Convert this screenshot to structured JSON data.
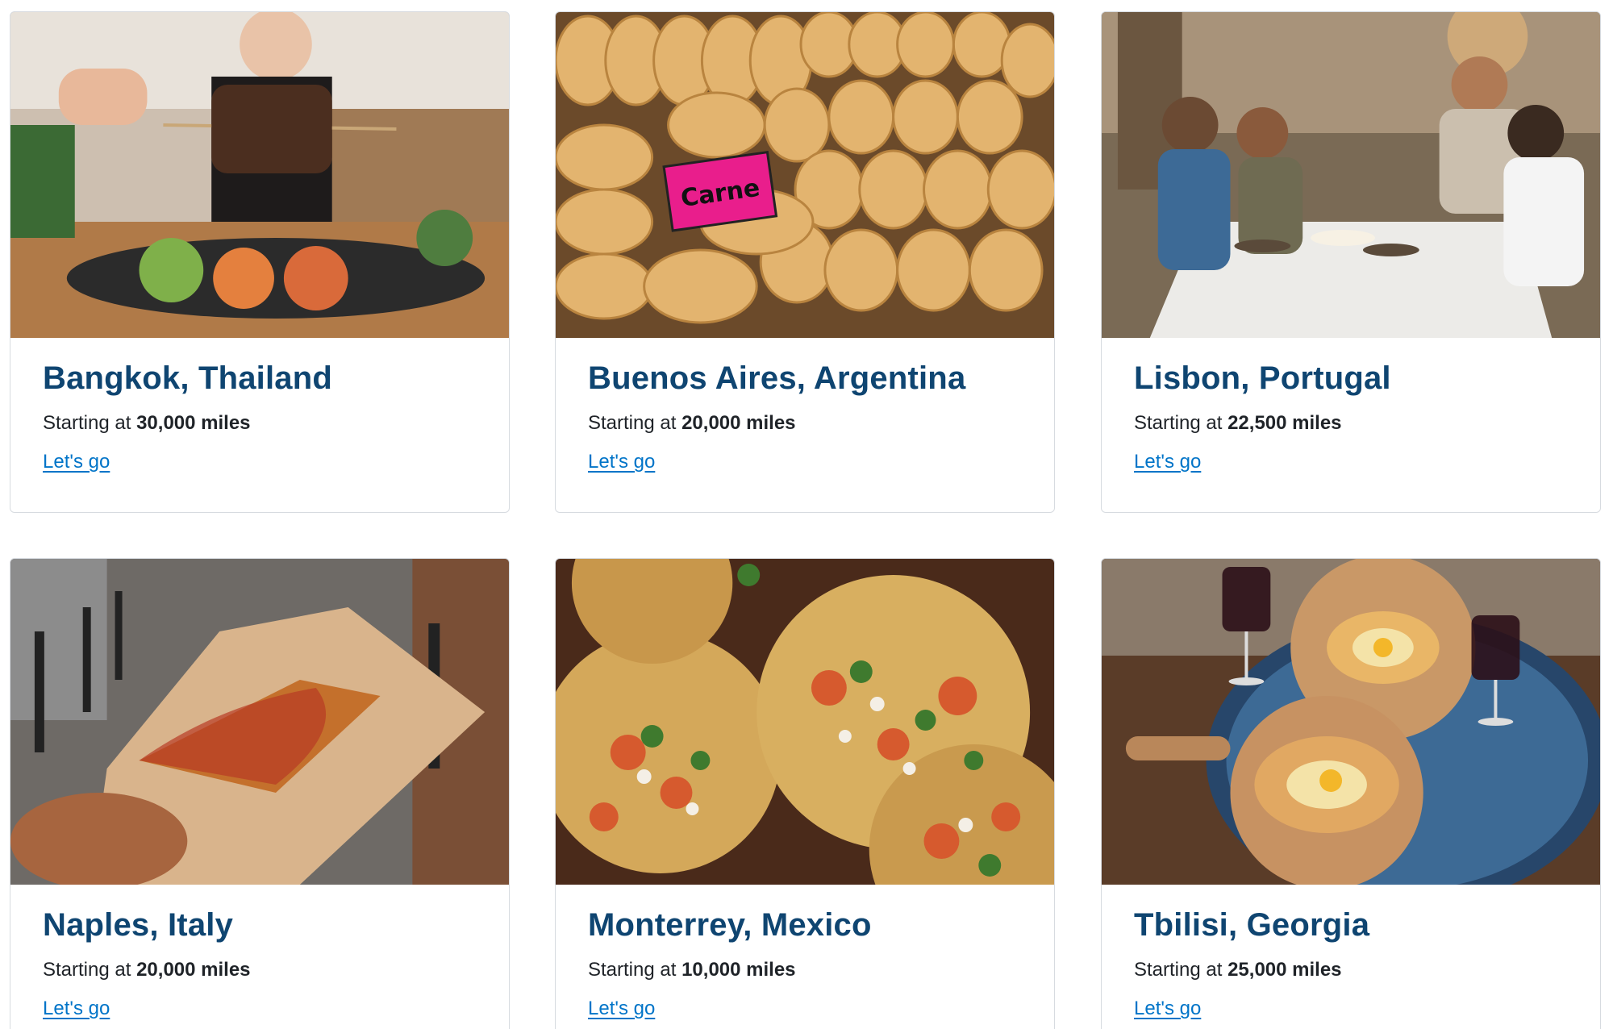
{
  "cards": [
    {
      "title": "Bangkok, Thailand",
      "prefix": "Starting at",
      "miles": "30,000 miles",
      "cta": "Let's go",
      "image": "thai-food-skewer-photo"
    },
    {
      "title": "Buenos Aires, Argentina",
      "prefix": "Starting at",
      "miles": "20,000 miles",
      "cta": "Let's go",
      "image": "empanadas-photo",
      "sign": "Carne"
    },
    {
      "title": "Lisbon, Portugal",
      "prefix": "Starting at",
      "miles": "22,500 miles",
      "cta": "Let's go",
      "image": "outdoor-dinner-toast-photo"
    },
    {
      "title": "Naples, Italy",
      "prefix": "Starting at",
      "miles": "20,000 miles",
      "cta": "Let's go",
      "image": "pizza-fold-street-photo"
    },
    {
      "title": "Monterrey, Mexico",
      "prefix": "Starting at",
      "miles": "10,000 miles",
      "cta": "Let's go",
      "image": "tacos-photo"
    },
    {
      "title": "Tbilisi, Georgia",
      "prefix": "Starting at",
      "miles": "25,000 miles",
      "cta": "Let's go",
      "image": "khachapuri-wine-photo"
    }
  ],
  "colors": {
    "title": "#0f4571",
    "link": "#0074c8",
    "border": "#d7dbe0"
  }
}
